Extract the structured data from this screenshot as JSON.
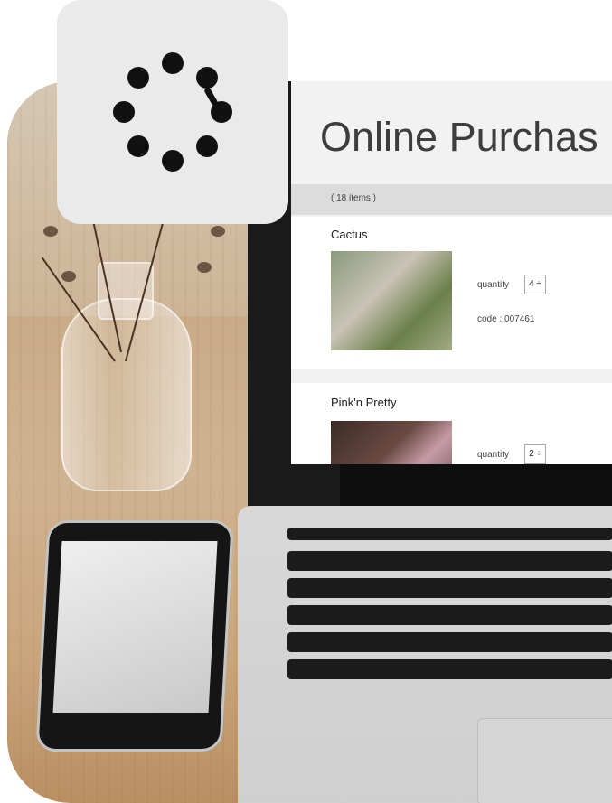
{
  "badge": {
    "icon": "loading-dots-icon"
  },
  "laptop_screen": {
    "title": "Online Purchas",
    "item_count": "( 18 items )",
    "products": [
      {
        "name": "Cactus",
        "quantity_label": "quantity",
        "quantity_value": "4 ÷",
        "code_label": "code :",
        "code_value": "007461"
      },
      {
        "name": "Pink'n Pretty",
        "quantity_label": "quantity",
        "quantity_value": "2 ÷"
      }
    ]
  },
  "colors": {
    "badge_bg": "#eaeaea",
    "screen_bg": "#f2f2f2",
    "title_text": "#3d3d3d"
  }
}
